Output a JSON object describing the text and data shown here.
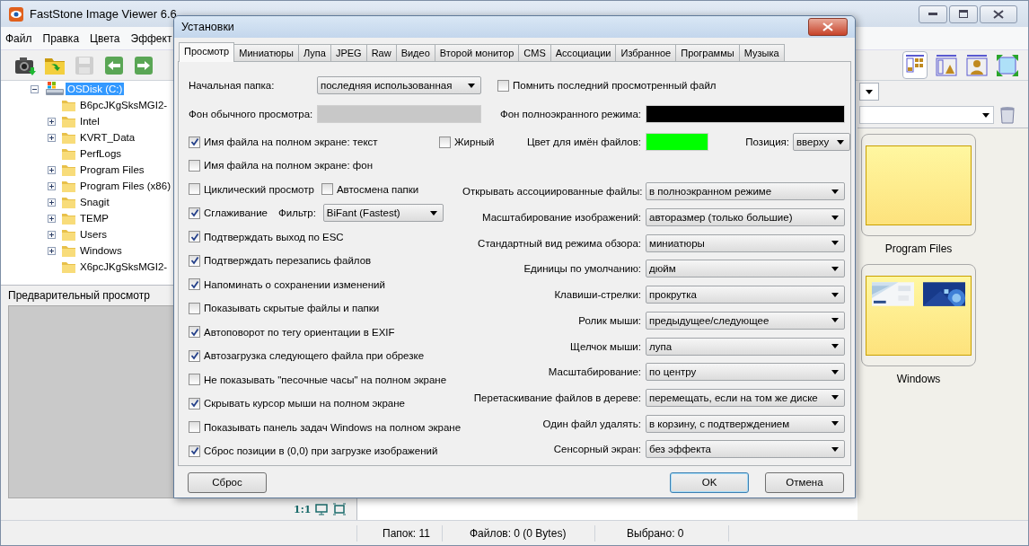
{
  "window": {
    "title": "FastStone Image Viewer 6.6"
  },
  "menu": [
    "Файл",
    "Правка",
    "Цвета",
    "Эффект"
  ],
  "tree": [
    {
      "label": "OSDisk (C:)",
      "selected": true,
      "expanded": true,
      "children": [
        {
          "label": "B6pcJKgSksMGI2-",
          "selected": false,
          "expandable": false
        },
        {
          "label": "Intel",
          "selected": false,
          "expandable": true
        },
        {
          "label": "KVRT_Data",
          "selected": false,
          "expandable": true
        },
        {
          "label": "PerfLogs",
          "selected": false,
          "expandable": false
        },
        {
          "label": "Program Files",
          "selected": false,
          "expandable": true
        },
        {
          "label": "Program Files (x86)",
          "selected": false,
          "expandable": true
        },
        {
          "label": "Snagit",
          "selected": false,
          "expandable": true
        },
        {
          "label": "TEMP",
          "selected": false,
          "expandable": true
        },
        {
          "label": "Users",
          "selected": false,
          "expandable": true
        },
        {
          "label": "Windows",
          "selected": false,
          "expandable": true
        },
        {
          "label": "X6pcJKgSksMGI2-",
          "selected": false,
          "expandable": false
        }
      ]
    }
  ],
  "preview": {
    "title": "Предварительный просмотр",
    "zoom_label": "1:1"
  },
  "thumbnails": [
    {
      "label": "Program Files",
      "kind": "empty"
    },
    {
      "label": "Windows",
      "kind": "with_pictures"
    }
  ],
  "status_bar": [
    "Папок: 11",
    "Файлов: 0 (0 Bytes)",
    "Выбрано: 0"
  ],
  "dialog": {
    "title": "Установки",
    "tabs": [
      {
        "label": "Просмотр",
        "selected": true
      },
      {
        "label": "Миниатюры",
        "selected": false
      },
      {
        "label": "Лупа",
        "selected": false
      },
      {
        "label": "JPEG",
        "selected": false
      },
      {
        "label": "Raw",
        "selected": false
      },
      {
        "label": "Видео",
        "selected": false
      },
      {
        "label": "Второй монитор",
        "selected": false
      },
      {
        "label": "CMS",
        "selected": false
      },
      {
        "label": "Ассоциации",
        "selected": false
      },
      {
        "label": "Избранное",
        "selected": false
      },
      {
        "label": "Программы",
        "selected": false
      },
      {
        "label": "Музыка",
        "selected": false
      }
    ],
    "start_folder": {
      "label": "Начальная папка:",
      "value": "последняя использованная"
    },
    "remember": {
      "label": "Помнить последний просмотренный файл",
      "checked": false
    },
    "swatches": [
      {
        "label": "Фон обычного просмотра:",
        "color": "#c8c8c8"
      },
      {
        "label": "Фон полноэкранного режима:",
        "color": "#000000"
      },
      {
        "label": "Цвет для имён файлов:",
        "color": "#00ff00"
      }
    ],
    "filename_text": {
      "label": "Имя файла на полном экране: текст",
      "checked": true
    },
    "bold": {
      "label": "Жирный",
      "checked": false
    },
    "position": {
      "label": "Позиция:",
      "value": "вверху"
    },
    "options": [
      {
        "controls": [
          {
            "kind": "checkbox",
            "label": "Имя файла на полном экране: фон",
            "checked": false
          }
        ]
      },
      {
        "controls": [
          {
            "kind": "checkbox",
            "label": "Циклический просмотр",
            "checked": false
          },
          {
            "kind": "checkbox",
            "label": "Автосмена папки",
            "checked": false
          }
        ]
      },
      {
        "controls": [
          {
            "kind": "checkbox",
            "label": "Сглаживание",
            "checked": true
          },
          {
            "kind": "dropdown",
            "label": "Фильтр:",
            "value": "BiFant (Fastest)"
          }
        ]
      },
      {
        "controls": [
          {
            "kind": "checkbox",
            "label": "Подтверждать выход по ESC",
            "checked": true
          }
        ]
      },
      {
        "controls": [
          {
            "kind": "checkbox",
            "label": "Подтверждать перезапись файлов",
            "checked": true
          }
        ]
      },
      {
        "controls": [
          {
            "kind": "checkbox",
            "label": "Напоминать о сохранении изменений",
            "checked": true
          }
        ]
      },
      {
        "controls": [
          {
            "kind": "checkbox",
            "label": "Показывать скрытые файлы и папки",
            "checked": false
          }
        ]
      },
      {
        "controls": [
          {
            "kind": "checkbox",
            "label": "Автоповорот по тегу ориентации в EXIF",
            "checked": true
          }
        ]
      },
      {
        "controls": [
          {
            "kind": "checkbox",
            "label": "Автозагрузка следующего файла при обрезке",
            "checked": true
          }
        ]
      },
      {
        "controls": [
          {
            "kind": "checkbox",
            "label": "Не показывать \"песочные часы\" на полном экране",
            "checked": false
          }
        ]
      },
      {
        "controls": [
          {
            "kind": "checkbox",
            "label": "Скрывать курсор мыши на полном экране",
            "checked": true
          }
        ]
      },
      {
        "controls": [
          {
            "kind": "checkbox",
            "label": "Показывать панель задач Windows на полном экране",
            "checked": false
          }
        ]
      },
      {
        "controls": [
          {
            "kind": "checkbox",
            "label": "Сброс позиции в (0,0) при загрузке изображений",
            "checked": true
          }
        ]
      }
    ],
    "dropdowns": [
      {
        "label": "Открывать ассоциированные файлы:",
        "value": "в полноэкранном режиме"
      },
      {
        "label": "Масштабирование изображений:",
        "value": "авторазмер (только большие)"
      },
      {
        "label": "Стандартный вид режима обзора:",
        "value": "миниатюры"
      },
      {
        "label": "Единицы по умолчанию:",
        "value": "дюйм"
      },
      {
        "label": "Клавиши-стрелки:",
        "value": "прокрутка"
      },
      {
        "label": "Ролик мыши:",
        "value": "предыдущее/следующее"
      },
      {
        "label": "Щелчок мыши:",
        "value": "лупа"
      },
      {
        "label": "Масштабирование:",
        "value": "по центру"
      },
      {
        "label": "Перетаскивание файлов в дереве:",
        "value": "перемещать, если на том же диске"
      },
      {
        "label": "Один файл удалять:",
        "value": "в корзину, с подтверждением"
      },
      {
        "label": "Сенсорный экран:",
        "value": "без эффекта"
      }
    ],
    "buttons": [
      {
        "label": "Сброс",
        "default": false
      },
      {
        "label": "OK",
        "default": true
      },
      {
        "label": "Отмена",
        "default": false
      }
    ]
  }
}
